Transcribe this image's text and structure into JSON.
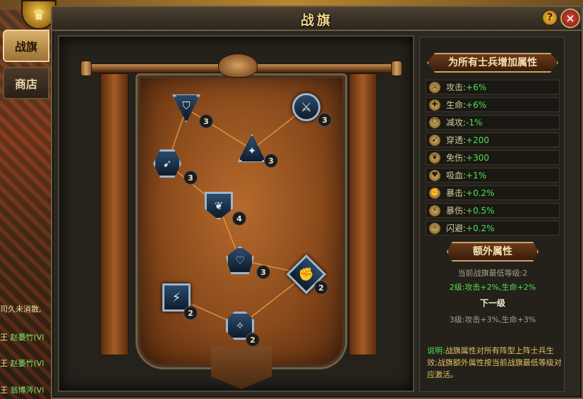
{
  "window": {
    "title": "战旗",
    "help_label": "?",
    "close_label": "✕"
  },
  "side_tabs": [
    {
      "label": "战旗",
      "active": true
    },
    {
      "label": "商店",
      "active": false
    }
  ],
  "chat": {
    "lines": [
      {
        "prefix": "",
        "name": "",
        "text": "司久未消散,"
      },
      {
        "prefix": "王",
        "name": "赵萎竹(VI",
        "text": ""
      },
      {
        "prefix": "王",
        "name": "赵萎竹(VI",
        "text": ""
      },
      {
        "prefix": "王",
        "name": "翁博涔(VI",
        "text": ""
      }
    ]
  },
  "banner_nodes": [
    {
      "name": "attack-reduce",
      "level": "3",
      "icon": "triangle-shield-icon"
    },
    {
      "name": "attack",
      "level": "3",
      "icon": "sword-circle-icon"
    },
    {
      "name": "hp",
      "level": "3",
      "icon": "strength-icon"
    },
    {
      "name": "penetrate",
      "level": "3",
      "icon": "arrow-hex-icon"
    },
    {
      "name": "damage-reduce",
      "level": "4",
      "icon": "wing-shield-icon"
    },
    {
      "name": "lifesteal",
      "level": "3",
      "icon": "heart-pentagon-icon"
    },
    {
      "name": "crit",
      "level": "2",
      "icon": "fist-diamond-icon"
    },
    {
      "name": "crit-damage",
      "level": "2",
      "icon": "blade-square-icon"
    },
    {
      "name": "dodge",
      "level": "2",
      "icon": "feather-octagon-icon"
    }
  ],
  "stats": {
    "heading": "为所有士兵增加属性",
    "rows": [
      {
        "name": "攻击:",
        "value": "+6%",
        "icon": "sword-icon"
      },
      {
        "name": "生命:",
        "value": "+6%",
        "icon": "cross-icon"
      },
      {
        "name": "减攻:",
        "value": "-1%",
        "icon": "shield-icon"
      },
      {
        "name": "穿透:",
        "value": "+200",
        "icon": "arrow-icon"
      },
      {
        "name": "免伤:",
        "value": "+300",
        "icon": "wing-icon"
      },
      {
        "name": "吸血:",
        "value": "+1%",
        "icon": "heart-icon"
      },
      {
        "name": "暴击:",
        "value": "+0.2%",
        "icon": "fist-icon"
      },
      {
        "name": "暴伤:",
        "value": "+0.5%",
        "icon": "blade-icon"
      },
      {
        "name": "闪避:",
        "value": "+0.2%",
        "icon": "feather-icon"
      }
    ],
    "extra_heading": "额外属性",
    "min_level_text": "当前战旗最低等级:2",
    "current_bonus": "2级:攻击+2%,生命+2%",
    "next_label": "下一级",
    "next_bonus": "3级:攻击+3%,生命+3%",
    "note_label": "说明:",
    "note_text": "战旗属性对所有阵型上阵士兵生效;战旗额外属性按当前战旗最低等级对应激活。"
  }
}
